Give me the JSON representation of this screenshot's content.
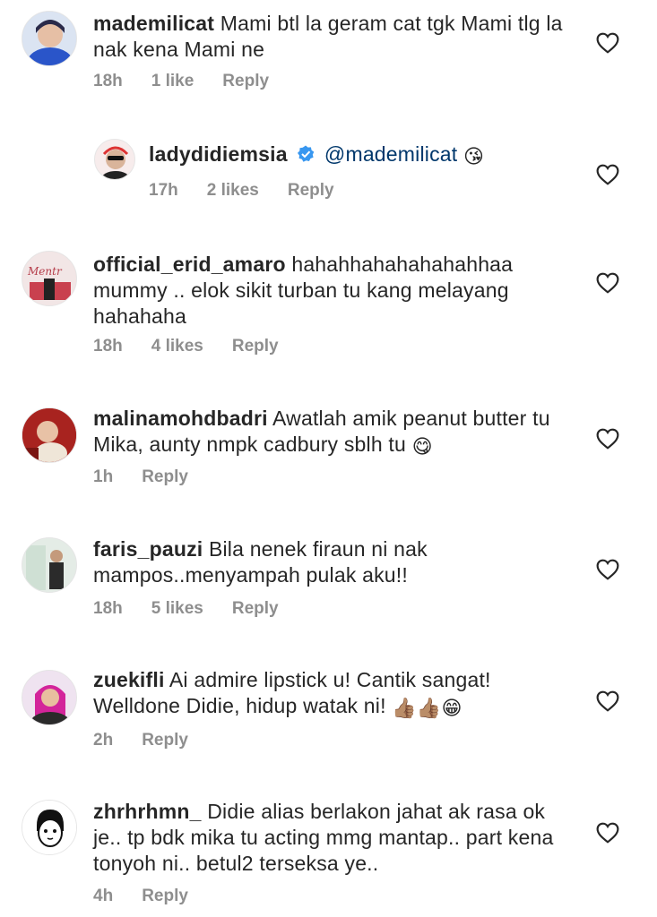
{
  "comments": [
    {
      "username": "mademilicat",
      "text": "Mami btl la geram cat tgk Mami tlg la nak kena Mami ne",
      "time": "18h",
      "likes": "1 like",
      "reply": "Reply"
    },
    {
      "username": "ladydidiemsia",
      "mention": "@mademilicat",
      "emoji": "😘",
      "time": "17h",
      "likes": "2 likes",
      "reply": "Reply"
    },
    {
      "username": "official_erid_amaro",
      "text": "hahahhahahahahahhaa mummy .. elok sikit turban tu kang melayang hahahaha",
      "time": "18h",
      "likes": "4 likes",
      "reply": "Reply"
    },
    {
      "username": "malinamohdbadri",
      "text": "Awatlah amik peanut butter tu Mika, aunty nmpk cadbury sblh tu",
      "emoji": "😋",
      "time": "1h",
      "reply": "Reply"
    },
    {
      "username": "faris_pauzi",
      "text": "Bila nenek firaun ni nak mampos..menyampah pulak aku!!",
      "time": "18h",
      "likes": "5 likes",
      "reply": "Reply"
    },
    {
      "username": "zuekifli",
      "text": "Ai admire lipstick u! Cantik sangat! Welldone Didie, hidup watak ni!",
      "emoji": "👍🏽👍🏽😁",
      "time": "2h",
      "reply": "Reply"
    },
    {
      "username": "zhrhrhmn_",
      "text": "Didie alias berlakon jahat ak rasa ok je.. tp bdk mika tu acting mmg mantap.. part kena tonyoh ni.. betul2 terseksa ye..",
      "time": "4h",
      "reply": "Reply"
    }
  ],
  "colors": {
    "username": "#262626",
    "meta": "#8e8e8e",
    "verified": "#3897f0",
    "mention": "#00376b"
  }
}
